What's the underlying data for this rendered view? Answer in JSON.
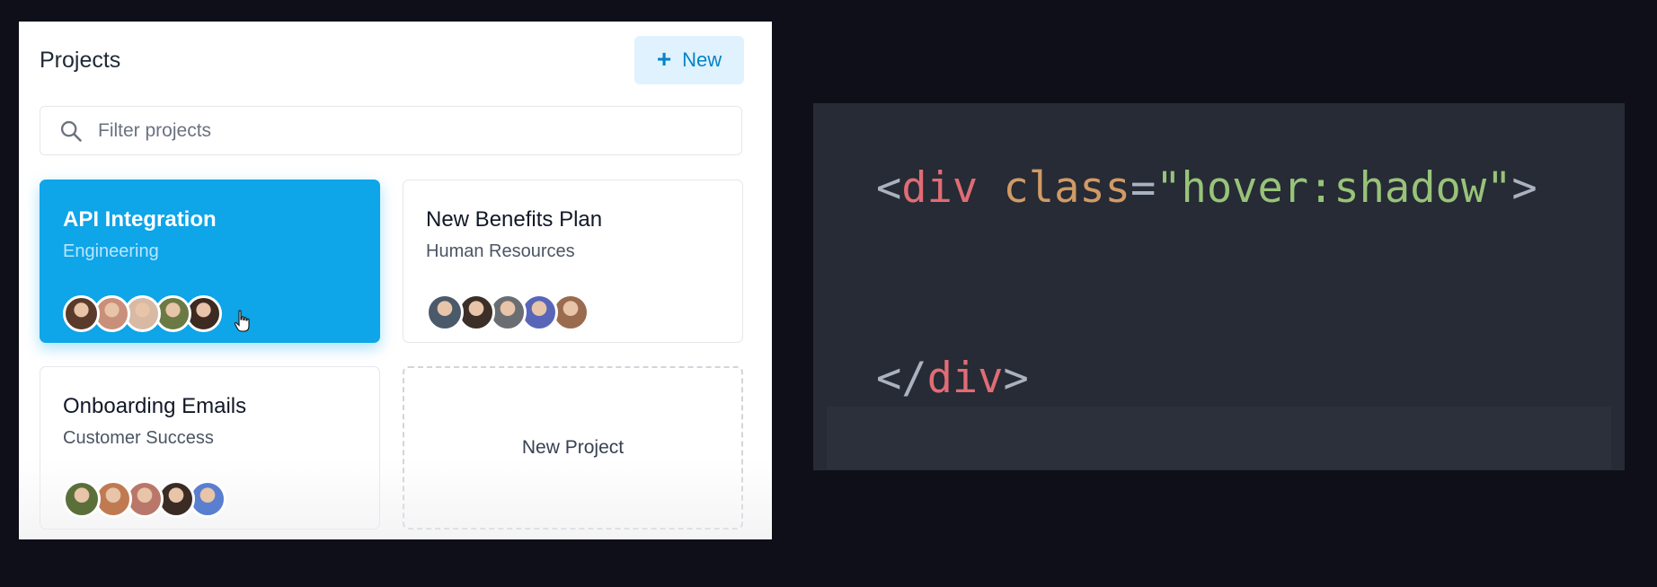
{
  "panel": {
    "title": "Projects",
    "new_button": {
      "icon": "plus-icon",
      "label": "New"
    },
    "search": {
      "placeholder": "Filter projects",
      "icon": "search-icon"
    },
    "projects": [
      {
        "title": "API Integration",
        "subtitle": "Engineering",
        "state": "hovered",
        "avatar_colors": [
          "#5a3a2a",
          "#c98f7a",
          "#d8b9a4",
          "#6b7a45",
          "#3d2a20"
        ]
      },
      {
        "title": "New Benefits Plan",
        "subtitle": "Human Resources",
        "state": "default",
        "avatar_colors": [
          "#4a5a6a",
          "#3b2f28",
          "#6a6e72",
          "#5966b8",
          "#9a6b4f"
        ]
      },
      {
        "title": "Onboarding Emails",
        "subtitle": "Customer Success",
        "state": "default",
        "avatar_colors": [
          "#5b6f3a",
          "#c07a52",
          "#b9776a",
          "#3a2c24",
          "#5a7ed0"
        ]
      }
    ],
    "new_project_label": "New Project"
  },
  "code": {
    "line1": {
      "open": "<",
      "tag": "div",
      "space": " ",
      "attr": "class",
      "eq": "=",
      "value": "\"hover:shadow\"",
      "close": ">"
    },
    "line2": {
      "open": "</",
      "tag": "div",
      "close": ">"
    }
  },
  "colors": {
    "accent": "#0ea5e9",
    "background": "#0e0f18",
    "code_background": "#262b35"
  }
}
